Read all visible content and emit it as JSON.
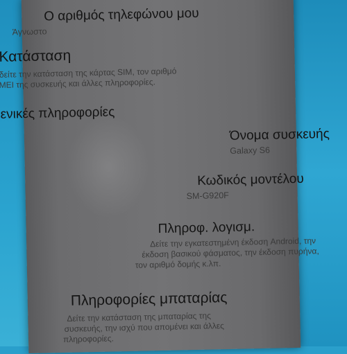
{
  "settings": {
    "phone_number": {
      "title": "Ο αριθμός τηλεφώνου μου",
      "value": "Άγνωστο"
    },
    "status": {
      "title": "Κατάσταση",
      "desc_line1": "δείτε την κατάσταση της κάρτας SIM, τον αριθμό",
      "desc_line2": "IMEI της συσκευής και άλλες πληροφορίες."
    },
    "general_info_header": "Γενικές πληροφορίες",
    "device_name": {
      "title": "Όνομα συσκευής",
      "value": "Galaxy S6"
    },
    "model_number": {
      "title": "Κωδικός μοντέλου",
      "value": "SM-G920F"
    },
    "software_info": {
      "title": "Πληροφ. λογισμ.",
      "desc_line1": "Δείτε την εγκατεστημένη έκδοση Android, την",
      "desc_line2": "έκδοση βασικού φάσματος, την έκδοση πυρήνα,",
      "desc_line3": "τον αριθμό δομής κ.λπ."
    },
    "battery_info": {
      "title": "Πληροφορίες μπαταρίας",
      "desc_line1": "Δείτε την κατάσταση της μπαταρίας της",
      "desc_line2": "συσκευής, την ισχύ που απομένει και άλλες",
      "desc_line3": "πληροφορίες."
    }
  }
}
